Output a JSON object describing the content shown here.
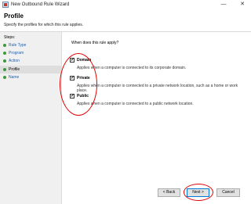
{
  "window": {
    "title": "New Outbound Rule Wizard",
    "minimize_glyph": "—",
    "close_glyph": "✕"
  },
  "header": {
    "title": "Profile",
    "subtitle": "Specify the profiles for which this rule applies."
  },
  "sidebar": {
    "steps_label": "Steps:",
    "items": [
      {
        "label": "Rule Type",
        "active": false
      },
      {
        "label": "Program",
        "active": false
      },
      {
        "label": "Action",
        "active": false
      },
      {
        "label": "Profile",
        "active": true
      },
      {
        "label": "Name",
        "active": false
      }
    ]
  },
  "main": {
    "question": "When does this rule apply?",
    "options": [
      {
        "label": "Domain",
        "checked": true,
        "description": "Applies when a computer is connected to its corporate domain."
      },
      {
        "label": "Private",
        "checked": true,
        "description": "Applies when a computer is connected to a private network location, such as a home or work place."
      },
      {
        "label": "Public",
        "checked": true,
        "description": "Applies when a computer is connected to a public network location."
      }
    ]
  },
  "buttons": {
    "back": "< Back",
    "next": "Next >",
    "cancel": "Cancel"
  },
  "colors": {
    "annotation": "#e00000",
    "step_bullet": "#3a9a3a",
    "link": "#1a5fb4"
  },
  "check_glyph": "✓"
}
